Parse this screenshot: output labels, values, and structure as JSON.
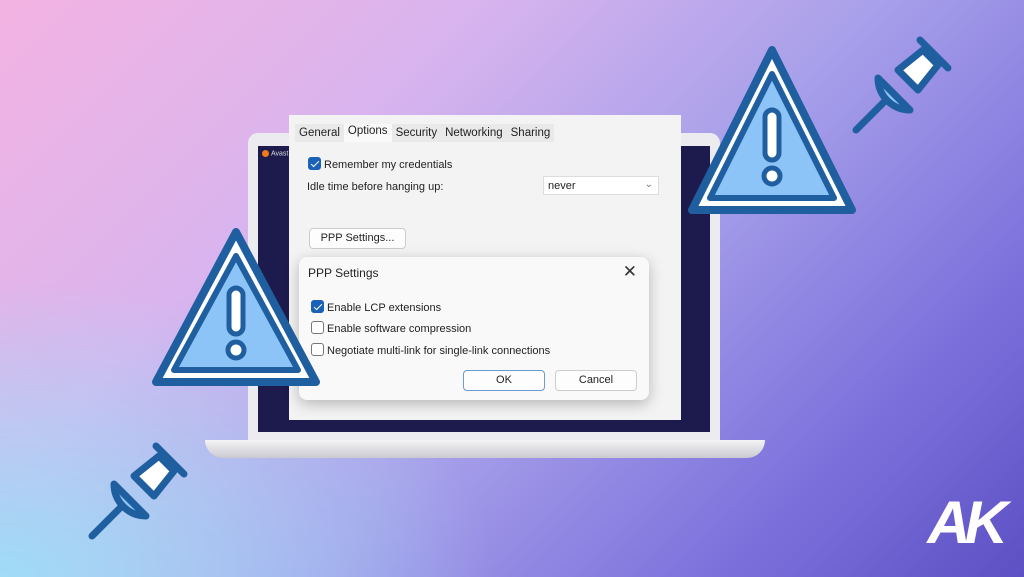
{
  "laptop": {
    "app_label": "Avast"
  },
  "window": {
    "tabs": [
      {
        "label": "General"
      },
      {
        "label": "Options",
        "active": true
      },
      {
        "label": "Security"
      },
      {
        "label": "Networking"
      },
      {
        "label": "Sharing"
      }
    ],
    "remember_credentials": {
      "label": "Remember my credentials",
      "checked": true
    },
    "idle_label": "Idle time before hanging up:",
    "idle_value": "never",
    "ppp_button": "PPP Settings..."
  },
  "dialog": {
    "title": "PPP Settings",
    "options": [
      {
        "label": "Enable LCP extensions",
        "checked": true
      },
      {
        "label": "Enable software compression",
        "checked": false
      },
      {
        "label": "Negotiate multi-link for single-link connections",
        "checked": false
      }
    ],
    "ok": "OK",
    "cancel": "Cancel"
  },
  "logo": "AK",
  "colors": {
    "warning_fill": "#8cc4f8",
    "warning_stroke": "#1f5fa0",
    "accent": "#1a61b8"
  }
}
